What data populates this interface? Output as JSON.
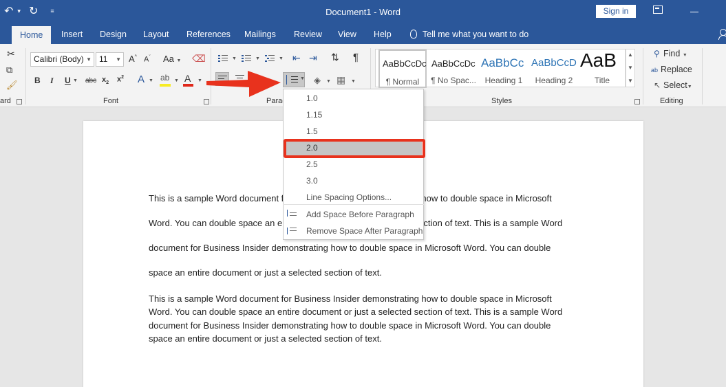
{
  "title_bar": {
    "title": "Document1  -  Word",
    "sign_in": "Sign in"
  },
  "tabs": [
    "Home",
    "Insert",
    "Design",
    "Layout",
    "References",
    "Mailings",
    "Review",
    "View",
    "Help"
  ],
  "tell_me": "Tell me what you want to do",
  "ribbon": {
    "clipboard_label": "ard",
    "font": {
      "name": "Calibri (Body)",
      "size": "11",
      "label": "Font",
      "case_btn": "Aa"
    },
    "paragraph_label": "Parag",
    "styles": {
      "label": "Styles",
      "items": [
        {
          "sample": "AaBbCcDc",
          "name": "¶ Normal"
        },
        {
          "sample": "AaBbCcDc",
          "name": "¶ No Spac..."
        },
        {
          "sample": "AaBbCc",
          "name": "Heading 1"
        },
        {
          "sample": "AaBbCcD",
          "name": "Heading 2"
        },
        {
          "sample": "AaB",
          "name": "Title"
        }
      ]
    },
    "editing": {
      "label": "Editing",
      "find": "Find",
      "replace": "Replace",
      "select": "Select"
    }
  },
  "line_spacing_menu": {
    "options": [
      "1.0",
      "1.15",
      "1.5",
      "2.0",
      "2.5",
      "3.0"
    ],
    "selected": "2.0",
    "more": "Line Spacing Options...",
    "add_before": "Add Space Before Paragraph",
    "remove_after": "Remove Space After Paragraph"
  },
  "document": {
    "paragraph1_lines": [
      "This is a sample Word document for Business Insider demonstrating how to double space in Microsoft",
      "Word. You can double space an entire document or just a selected section of text. This is a sample Word",
      "document for Business Insider demonstrating how to double space in Microsoft Word. You can double",
      "space an entire document or just a selected section of text."
    ],
    "paragraph2_lines": [
      "This is a sample Word document for Business Insider demonstrating how to double space in Microsoft",
      "Word. You can double space an entire document or just a selected section of text. This is a sample Word",
      "document for Business Insider demonstrating how to double space in Microsoft Word. You can double",
      "space an entire document or just a selected section of text."
    ]
  },
  "colors": {
    "word_blue": "#2b579a",
    "highlight_red": "#e8321d",
    "menu_selected": "#c5c5c5"
  }
}
